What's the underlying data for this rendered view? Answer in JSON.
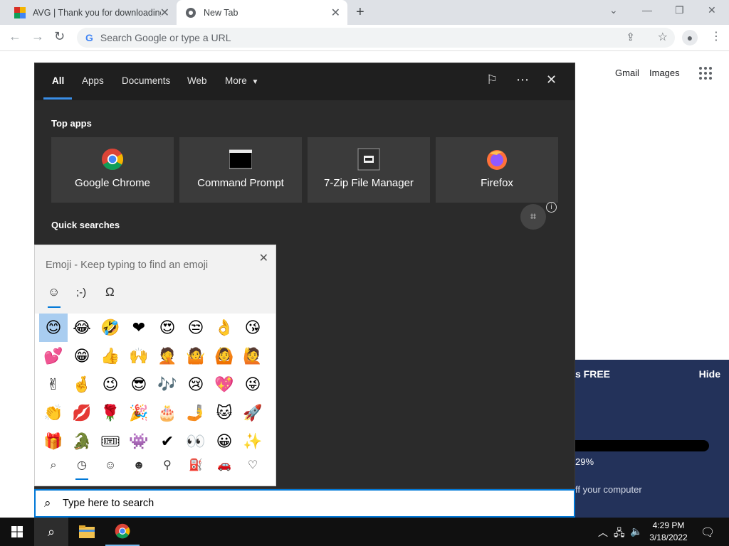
{
  "browser": {
    "tabs": [
      {
        "title": "AVG | Thank you for downloading",
        "close": "✕"
      },
      {
        "title": "New Tab",
        "close": "✕"
      }
    ],
    "new_tab_symbol": "+",
    "omnibox_placeholder": "Search Google or type a URL",
    "omnibox_g": "G"
  },
  "ntp": {
    "gmail": "Gmail",
    "images": "Images"
  },
  "avg_popup": {
    "free_text": "s FREE",
    "hide": "Hide",
    "progress_percent_text": "29%",
    "progress_fraction": 0.29,
    "message": "ff your computer"
  },
  "search_panel": {
    "tabs": [
      "All",
      "Apps",
      "Documents",
      "Web",
      "More"
    ],
    "more_caret": "▼",
    "top_apps_label": "Top apps",
    "apps": [
      {
        "name": "Google Chrome",
        "icon": "chrome-icon"
      },
      {
        "name": "Command Prompt",
        "icon": "cmd-icon"
      },
      {
        "name": "7-Zip File Manager",
        "icon": "7zip-icon"
      },
      {
        "name": "Firefox",
        "icon": "firefox-icon"
      }
    ],
    "quick_searches_label": "Quick searches",
    "info": "i"
  },
  "emoji_panel": {
    "title": "Emoji - Keep typing to find an emoji",
    "close": "✕",
    "categories": [
      "☺",
      ";-)",
      "Ω"
    ],
    "emojis": [
      "😊",
      "😂",
      "🤣",
      "❤",
      "😍",
      "😒",
      "👌",
      "😘",
      "💕",
      "😁",
      "👍",
      "🙌",
      "🤦",
      "🤷",
      "🙆",
      "🙋",
      "✌",
      "🤞",
      "😉",
      "😎",
      "🎶",
      "😢",
      "💖",
      "😜",
      "👏",
      "💋",
      "🌹",
      "🎉",
      "🎂",
      "🤳",
      "🐱",
      "🚀",
      "🎁",
      "🐊",
      "🎟",
      "👾",
      "✔",
      "👀",
      "😀",
      "✨"
    ],
    "nav": [
      "⌕",
      "◷",
      "☺",
      "☻",
      "⚲",
      "⛽",
      "🚗",
      "♡"
    ]
  },
  "searchbox": {
    "placeholder": "Type here to search"
  },
  "taskbar": {
    "time": "4:29 PM",
    "date": "3/18/2022"
  }
}
